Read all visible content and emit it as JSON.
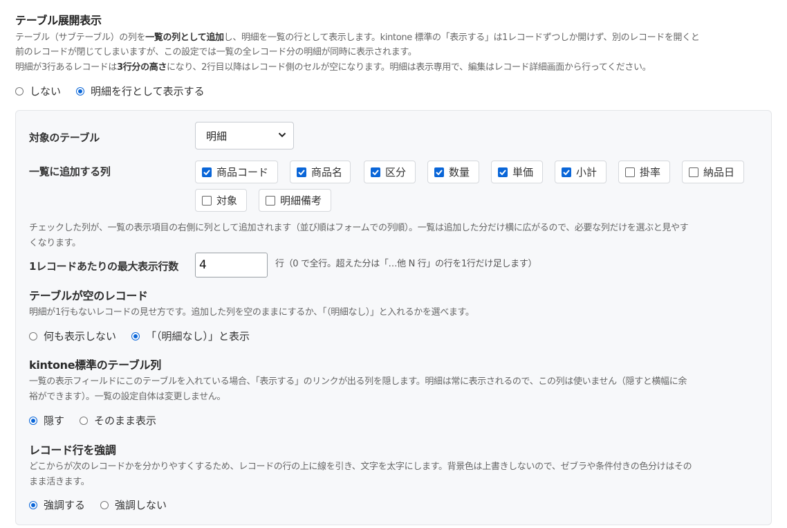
{
  "header": {
    "title": "テーブル展開表示",
    "desc_line1_a": "テーブル（サブテーブル）の列を",
    "desc_line1_b": "一覧の列として追加",
    "desc_line1_c": "し、明細を一覧の行として表示します。kintone 標準の「表示する」は1レコードずつしか開けず、別のレコードを開くと",
    "desc_line2": "前のレコードが閉じてしまいますが、この設定では一覧の全レコード分の明細が同時に表示されます。",
    "desc_line3_a": "明細が3行あるレコードは",
    "desc_line3_b": "3行分の高さ",
    "desc_line3_c": "になり、2行目以降はレコード側のセルが空になります。明細は表示専用で、編集はレコード詳細画面から行ってください。",
    "mode_options": [
      "しない",
      "明細を行として表示する"
    ],
    "mode_selected": 1
  },
  "panel": {
    "target_table": {
      "label": "対象のテーブル",
      "value": "明細"
    },
    "columns": {
      "label": "一覧に追加する列",
      "items": [
        {
          "label": "商品コード",
          "checked": true
        },
        {
          "label": "商品名",
          "checked": true
        },
        {
          "label": "区分",
          "checked": true
        },
        {
          "label": "数量",
          "checked": true
        },
        {
          "label": "単価",
          "checked": true
        },
        {
          "label": "小計",
          "checked": true
        },
        {
          "label": "掛率",
          "checked": false
        },
        {
          "label": "納品日",
          "checked": false
        },
        {
          "label": "対象",
          "checked": false
        },
        {
          "label": "明細備考",
          "checked": false
        }
      ],
      "help_line1": "チェックした列が、一覧の表示項目の右側に列として追加されます（並び順はフォームでの列順）。一覧は追加した分だけ横に広がるので、必要な列だけを選ぶと見やす",
      "help_line2": "くなります。"
    },
    "max_rows": {
      "label": "1レコードあたりの最大表示行数",
      "value": "4",
      "suffix": "行（0 で全行。超えた分は「…他 N 行」の行を1行だけ足します）"
    },
    "empty_table": {
      "title": "テーブルが空のレコード",
      "help": "明細が1行もないレコードの見せ方です。追加した列を空のままにするか、「（明細なし）」と入れるかを選べます。",
      "options": [
        "何も表示しない",
        "「（明細なし）」と表示"
      ],
      "selected": 1
    },
    "std_column": {
      "title": "kintone標準のテーブル列",
      "help_line1": "一覧の表示フィールドにこのテーブルを入れている場合、「表示する」のリンクが出る列を隠します。明細は常に表示されるので、この列は使いません（隠すと横幅に余",
      "help_line2": "裕ができます）。一覧の設定自体は変更しません。",
      "options": [
        "隠す",
        "そのまま表示"
      ],
      "selected": 0
    },
    "emphasize": {
      "title": "レコード行を強調",
      "help_line1": "どこからが次のレコードかを分かりやすくするため、レコードの行の上に線を引き、文字を太字にします。背景色は上書きしないので、ゼブラや条件付きの色分けはその",
      "help_line2": "まま活きます。",
      "options": [
        "強調する",
        "強調しない"
      ],
      "selected": 0
    }
  },
  "colors": {
    "accent": "#0a66d8",
    "panel_bg": "#f7f8fa",
    "panel_border": "#e3e5e8"
  }
}
